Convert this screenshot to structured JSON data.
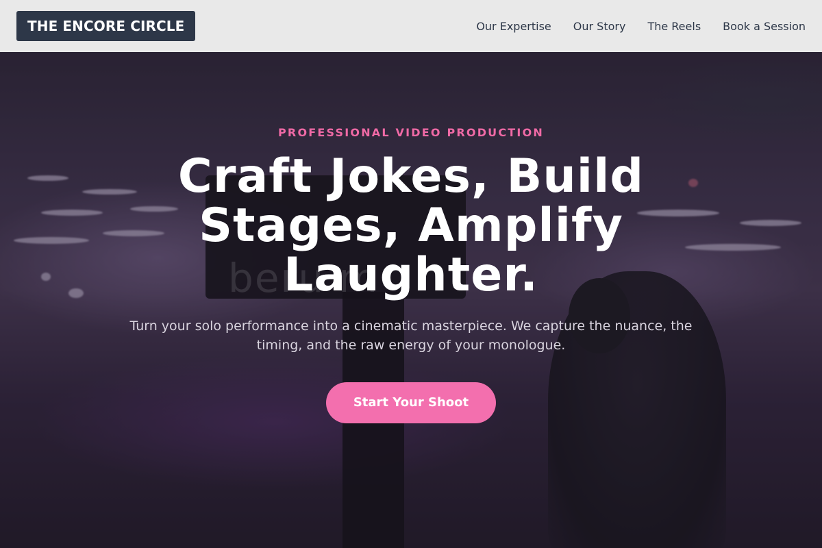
{
  "header": {
    "logo": "THE ENCORE CIRCLE",
    "nav": [
      {
        "label": "Our Expertise"
      },
      {
        "label": "Our Story"
      },
      {
        "label": "The Reels"
      },
      {
        "label": "Book a Session"
      }
    ]
  },
  "hero": {
    "eyebrow": "PROFESSIONAL VIDEO PRODUCTION",
    "headline": "Craft Jokes, Build Stages, Amplify Laughter.",
    "subtext": "Turn your solo performance into a cinematic masterpiece. We capture the nuance, the timing, and the raw energy of your monologue.",
    "cta_label": "Start Your Shoot",
    "watermark": "beru       m"
  },
  "colors": {
    "accent": "#f36fae",
    "eyebrow": "#f06aa6",
    "logo_bg": "#2d3748",
    "header_bg": "#e9e9e9",
    "nav_text": "#2d3748"
  }
}
